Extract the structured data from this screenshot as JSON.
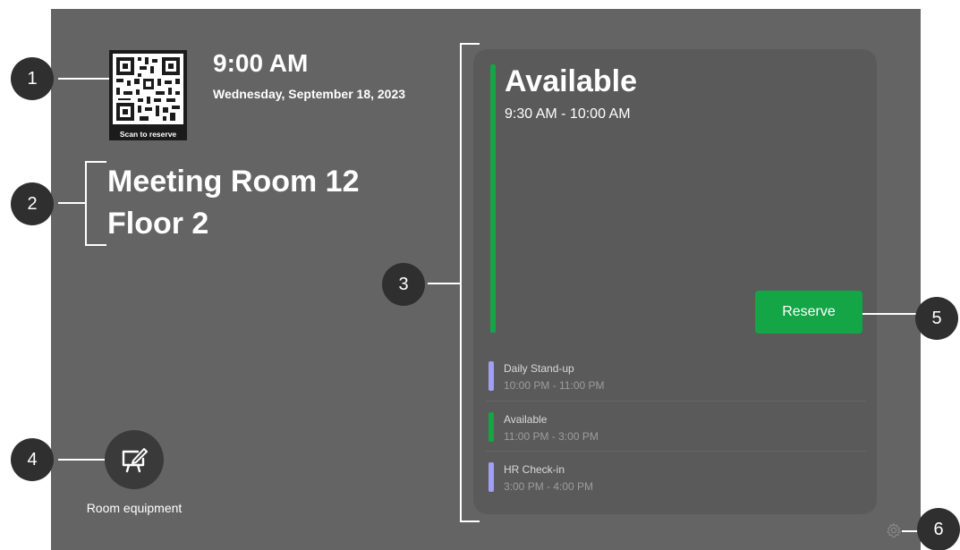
{
  "device": {
    "qr_label": "Scan to reserve",
    "time": "9:00 AM",
    "date": "Wednesday, September 18, 2023",
    "room_name": "Meeting Room 12",
    "room_floor": "Floor 2",
    "equipment_label": "Room equipment",
    "equipment_icon": "whiteboard-pen-icon",
    "settings_icon": "gear-icon"
  },
  "status": {
    "title": "Available",
    "time": "9:30 AM - 10:00 AM",
    "color": "#13a546",
    "reserve_label": "Reserve"
  },
  "meetings": [
    {
      "title": "Daily Stand-up",
      "time": "10:00 PM - 11:00 PM",
      "color": "#a1a0f0"
    },
    {
      "title": "Available",
      "time": "11:00 PM - 3:00 PM",
      "color": "#13a546"
    },
    {
      "title": "HR Check-in",
      "time": "3:00 PM - 4:00 PM",
      "color": "#a1a0f0"
    }
  ],
  "callouts": [
    "1",
    "2",
    "3",
    "4",
    "5",
    "6"
  ]
}
